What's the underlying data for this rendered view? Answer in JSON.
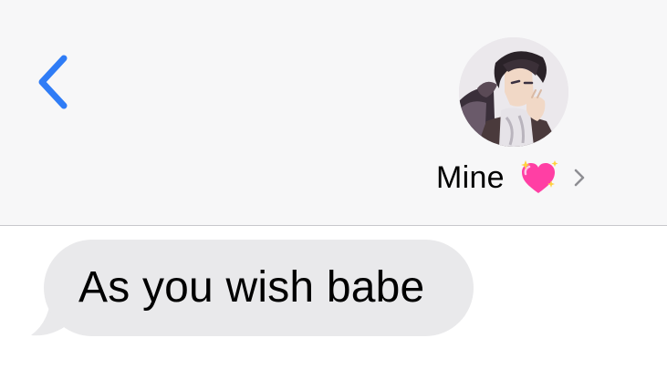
{
  "header": {
    "back_icon": "chevron-left-icon",
    "accent_color": "#2f7cf6",
    "background_color": "#f7f7f8"
  },
  "contact": {
    "name": "Mine",
    "emoji": "💖",
    "emoji_icon": "sparkling-heart-icon",
    "disclosure_icon": "chevron-right-icon",
    "avatar_icon": "contact-avatar"
  },
  "messages": [
    {
      "direction": "incoming",
      "text": "As you wish babe",
      "bubble_color": "#e9e9eb"
    }
  ]
}
